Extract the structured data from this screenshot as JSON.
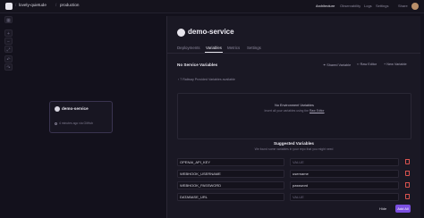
{
  "topbar": {
    "project": "lovely-quietude",
    "environment": "production",
    "nav": [
      "Architecture",
      "Observability",
      "Logs",
      "Settings",
      "Share"
    ]
  },
  "canvas": {
    "card_title": "demo-service",
    "card_status": "4 minutes ago via GitHub"
  },
  "panel": {
    "service_name": "demo-service",
    "tabs": [
      "Deployments",
      "Variables",
      "Metrics",
      "Settings"
    ],
    "section_title": "No Service Variables",
    "actions": [
      "Shared Variable",
      "Raw Editor",
      "+ New Variable"
    ],
    "railway_provided": "7 Railway Provided Variables available",
    "empty_title": "No Environment Variables",
    "empty_sub_prefix": "Insert all your variables using the",
    "empty_sub_link": "Raw Editor",
    "suggested_title": "Suggested Variables",
    "suggested_sub": "We found some variables in your repo that you might need",
    "suggested": [
      {
        "key": "OPENAI_API_KEY",
        "value": "VALUE",
        "placeholder": true
      },
      {
        "key": "WEBHOOK_USERNAME",
        "value": "username",
        "placeholder": false
      },
      {
        "key": "WEBHOOK_PASSWORD",
        "value": "password",
        "placeholder": false
      },
      {
        "key": "DATABASE_URL",
        "value": "VALUE",
        "placeholder": true
      }
    ],
    "hide_label": "Hide",
    "add_all_label": "Add All"
  },
  "colors": {
    "accent": "#7b4fe0",
    "danger": "#d9534f",
    "background": "#13111c"
  }
}
